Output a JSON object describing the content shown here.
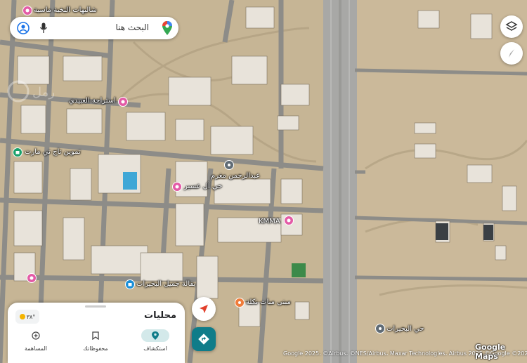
{
  "search": {
    "placeholder": "البحث هنا"
  },
  "poi": {
    "top_left": "شاليهات النخبة ماسية",
    "istiraha": "استراحة العبيدي",
    "tm_mart": "تموين تاج تي مارت",
    "abdulrahman": "عبدالرحمن مغرم",
    "hay_aseer": "حي آل عسير",
    "kmma": "KMMA",
    "jameel_abqari": "بقالة جميل البحيرات",
    "mabat": "مبنى مبات نكلة",
    "buhayrat": "حي البحيرات",
    "logo_left": "رمل"
  },
  "sheet": {
    "title": "محليات",
    "weather": "٣٨°",
    "tabs": [
      {
        "label": "استكشاف"
      },
      {
        "label": "محفوظاتك"
      },
      {
        "label": "المساهمة"
      }
    ]
  },
  "attribution": "Google 2025، ©Airbus، ©NES/Airbus، Maxar Technologies، Airbus 2025 ©Google ©2025",
  "logo": "Google Maps",
  "colors": {
    "sand": "#cdbb9b",
    "road": "#8d8c88",
    "highway": "#a8a8a6",
    "pin_pink": "#e35ba6",
    "pin_green": "#1aa06a",
    "pin_blue": "#1a8fd8",
    "pin_orange": "#ef7c3a",
    "pin_gray": "#5f6b75",
    "accent_teal": "#0f7c89",
    "nav_red": "#e2402c"
  }
}
